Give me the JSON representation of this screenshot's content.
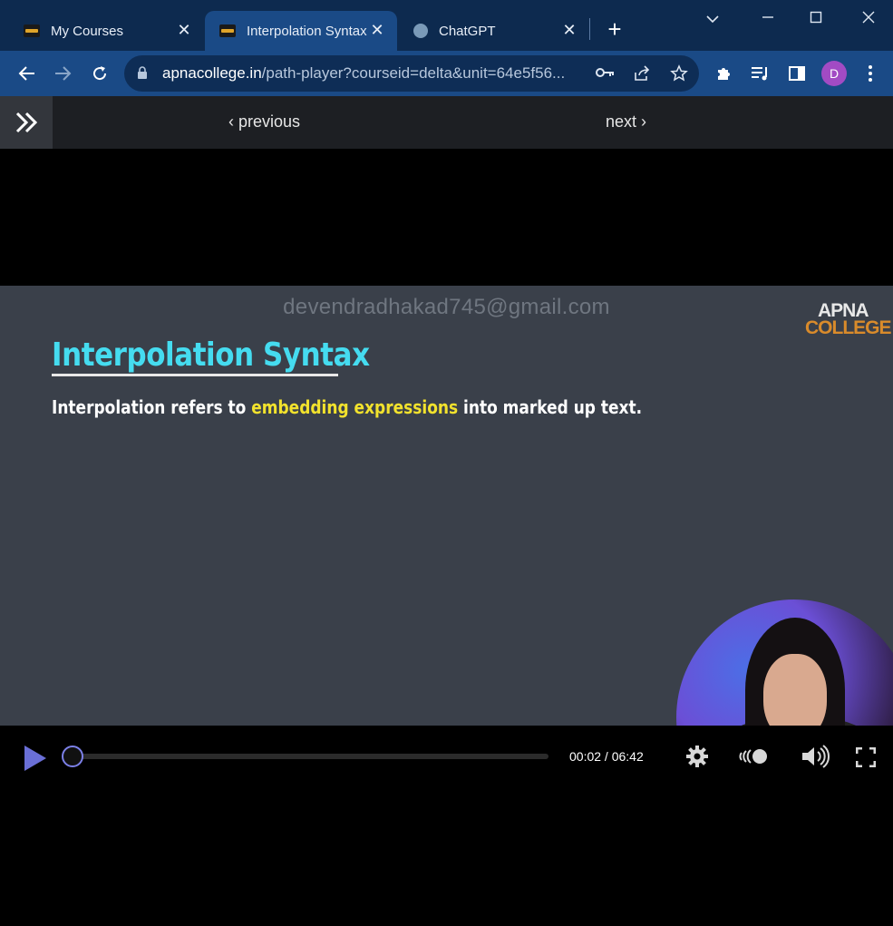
{
  "browser": {
    "tabs": [
      {
        "title": "My Courses",
        "active": false
      },
      {
        "title": "Interpolation Syntax",
        "active": true
      },
      {
        "title": "ChatGPT",
        "active": false
      }
    ],
    "url_domain": "apnacollege.in",
    "url_path": "/path-player?courseid=delta&unit=64e5f56...",
    "profile_initial": "D"
  },
  "player_nav": {
    "previous_label": "previous",
    "next_label": "next"
  },
  "slide": {
    "watermark": "devendradhakad745@gmail.com",
    "logo_line1": "APNA",
    "logo_line2": "COLLEGE",
    "title": "Interpolation Syntax",
    "text_before": "Interpolation refers to ",
    "text_highlight": "embedding expressions",
    "text_after": " into marked up text."
  },
  "player_controls": {
    "current_time": "00:02",
    "duration": "06:42",
    "time_display": "00:02 / 06:42",
    "progress_fraction": 0.005
  },
  "colors": {
    "accent": "#6a6fd6",
    "title_color": "#45dcf0",
    "highlight_color": "#f2e22d",
    "brand_orange": "#d98b2b"
  }
}
